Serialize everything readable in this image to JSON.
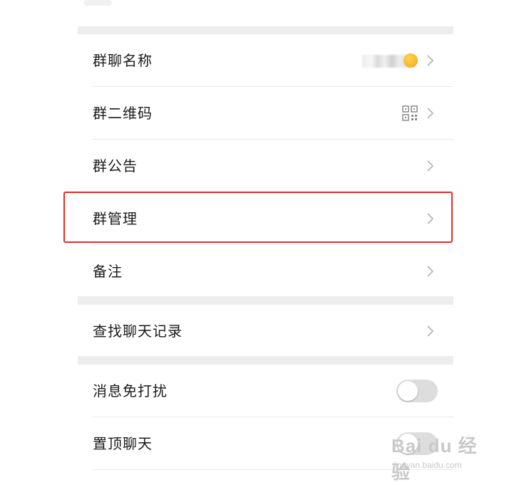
{
  "settings": {
    "rows": [
      {
        "label": "群聊名称"
      },
      {
        "label": "群二维码"
      },
      {
        "label": "群公告"
      },
      {
        "label": "群管理"
      },
      {
        "label": "备注"
      },
      {
        "label": "查找聊天记录"
      },
      {
        "label": "消息免打扰",
        "toggle": false
      },
      {
        "label": "置顶聊天",
        "toggle": false
      }
    ]
  },
  "watermark": {
    "brand": "Bai du 经验",
    "site": "jingyan.baidu.com"
  },
  "colors": {
    "highlight": "#d9302b",
    "section_gap": "#ededed",
    "toggle_off": "#dddddd"
  },
  "icons": [
    "chevron-right-icon",
    "qr-code-icon",
    "emoji-icon"
  ]
}
